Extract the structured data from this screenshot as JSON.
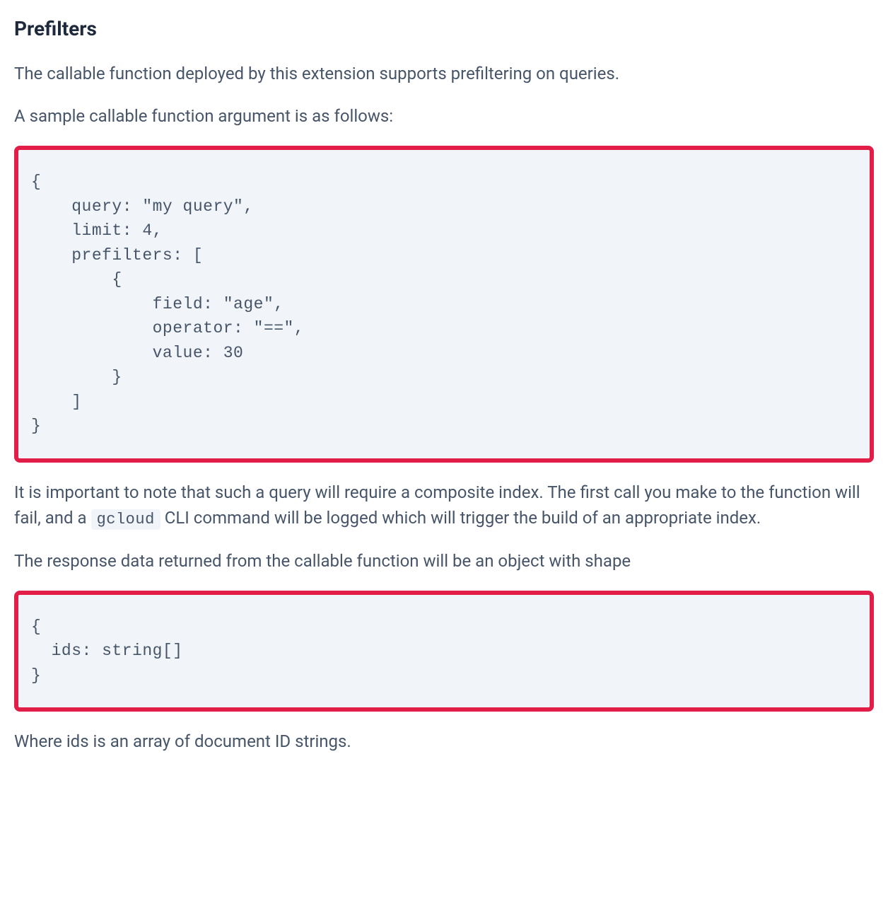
{
  "heading": "Prefilters",
  "paragraph1": "The callable function deployed by this extension supports prefiltering on queries.",
  "paragraph2": "A sample callable function argument is as follows:",
  "codeBlock1": "{\n    query: \"my query\",\n    limit: 4,\n    prefilters: [\n        {\n            field: \"age\",\n            operator: \"==\",\n            value: 30\n        }\n    ]\n}",
  "paragraph3_part1": "It is important to note that such a query will require a composite index. The first call you make to the function will fail, and a ",
  "inlineCode1": "gcloud",
  "paragraph3_part2": " CLI command will be logged which will trigger the build of an appropriate index.",
  "paragraph4": "The response data returned from the callable function will be an object with shape",
  "codeBlock2": "{\n  ids: string[]\n}",
  "paragraph5": "Where ids is an array of document ID strings."
}
